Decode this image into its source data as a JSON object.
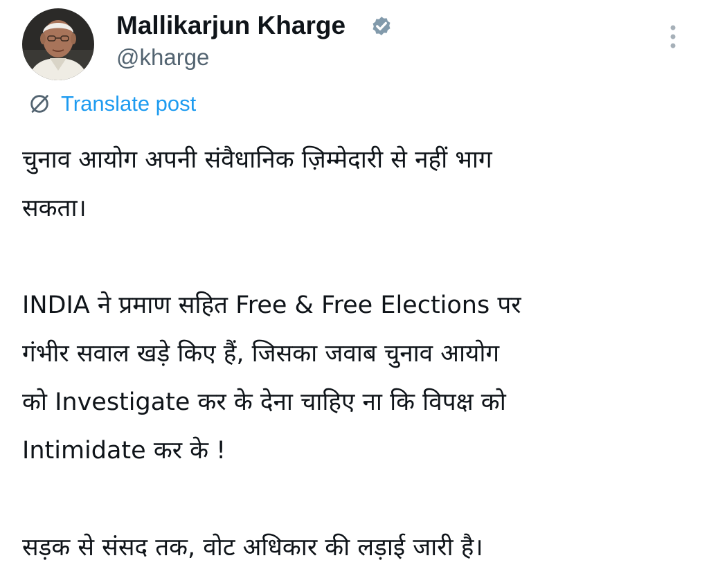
{
  "author": {
    "display_name": "Mallikarjun Kharge",
    "handle": "@kharge",
    "verified_icon": "verified-badge-icon",
    "verified_color": "#829aab",
    "avatar_icon": "profile-photo"
  },
  "toolbar": {
    "more_icon": "vertical-ellipsis-icon",
    "translate_icon": "globe-icon",
    "translate_label": "Translate post"
  },
  "post": {
    "paragraph1_line1": "चुनाव आयोग अपनी संवैधानिक ज़िम्मेदारी से नहीं भाग",
    "paragraph1_line2": "सकता।",
    "paragraph2_line1": "INDIA ने प्रमाण सहित Free & Free Elections पर",
    "paragraph2_line2": "गंभीर सवाल खड़े किए हैं, जिसका जवाब चुनाव आयोग",
    "paragraph2_line3": "को Investigate कर के देना चाहिए ना कि विपक्ष को",
    "paragraph2_line4": "Intimidate कर के !",
    "paragraph3_line1": "सड़क से संसद तक, वोट अधिकार की लड़ाई जारी है।"
  },
  "colors": {
    "text": "#0f1419",
    "secondary": "#536471",
    "link": "#1d9bf0",
    "background": "#ffffff"
  }
}
